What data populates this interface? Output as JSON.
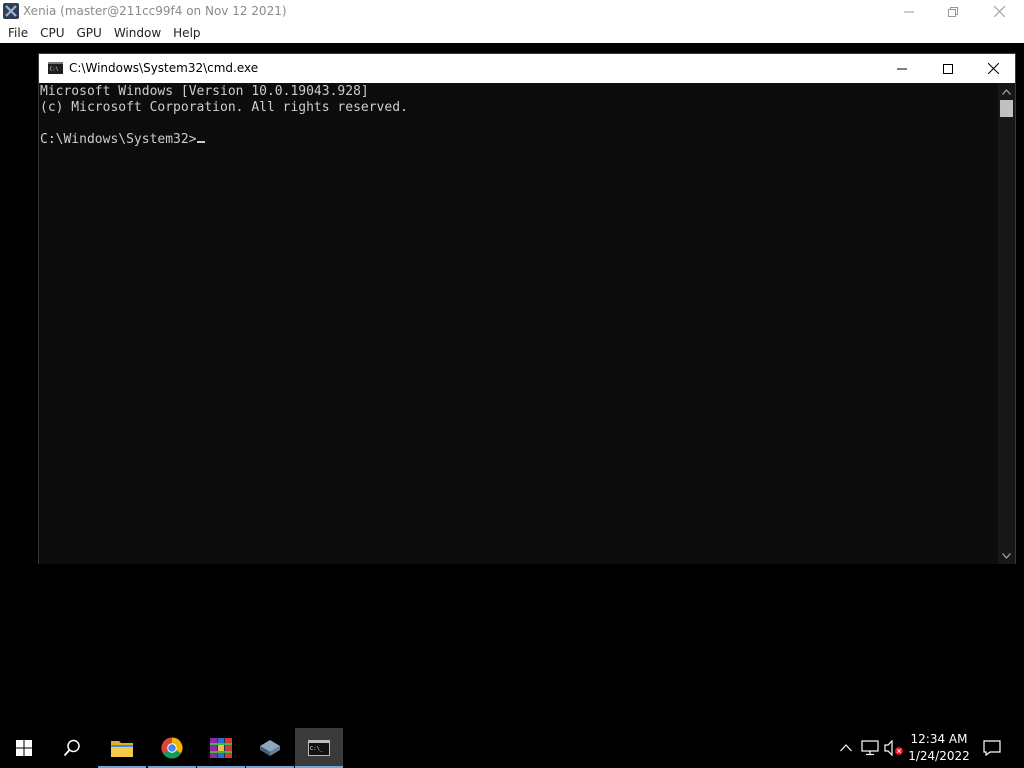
{
  "host": {
    "title": "Xenia (master@211cc99f4 on Nov 12 2021)",
    "menu": [
      "File",
      "CPU",
      "GPU",
      "Window",
      "Help"
    ]
  },
  "cmd": {
    "title": "C:\\Windows\\System32\\cmd.exe",
    "lines": [
      "Microsoft Windows [Version 10.0.19043.928]",
      "(c) Microsoft Corporation. All rights reserved.",
      "",
      "C:\\Windows\\System32>"
    ]
  },
  "taskbar": {
    "apps": [
      "start-icon",
      "search-icon",
      "file-explorer-icon",
      "chrome-icon",
      "winrar-icon",
      "virtualbox-icon",
      "cmd-icon"
    ],
    "active_app": "cmd-icon",
    "clock": {
      "time": "12:34 AM",
      "date": "1/24/2022"
    }
  },
  "colors": {
    "console_bg": "#0c0c0c",
    "console_fg": "#cccccc",
    "taskbar_bg": "#000000",
    "taskbar_accent": "#6ea6d8"
  }
}
